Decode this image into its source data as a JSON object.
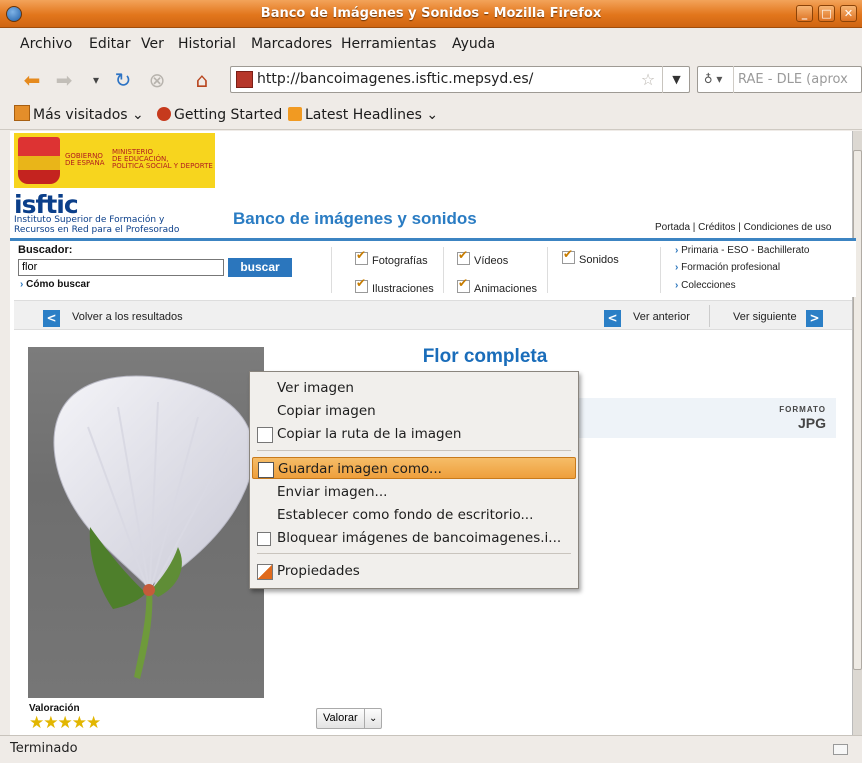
{
  "window": {
    "title": "Banco de Imágenes y Sonidos - Mozilla Firefox"
  },
  "menu": [
    "Archivo",
    "Editar",
    "Ver",
    "Historial",
    "Marcadores",
    "Herramientas",
    "Ayuda"
  ],
  "address": {
    "url": "http://bancoimagenes.isftic.mepsyd.es/"
  },
  "search_engine": {
    "placeholder": "RAE - DLE (aprox"
  },
  "bookmarks": [
    "Más visitados",
    "Getting Started",
    "Latest Headlines"
  ],
  "site": {
    "gov_text_1": "GOBIERNO",
    "gov_text_2": "DE ESPAÑA",
    "min_text_1": "MINISTERIO",
    "min_text_2": "DE EDUCACIÓN,",
    "min_text_3": "POLÍTICA SOCIAL Y DEPORTE",
    "logo": "isftic",
    "logo_sub_1": "Instituto Superior de Formación y",
    "logo_sub_2": "Recursos en Red para el Profesorado",
    "title": "Banco de imágenes y sonidos",
    "top_links": "Portada | Créditos | Condiciones de uso"
  },
  "search": {
    "label": "Buscador:",
    "value": "flor",
    "button": "buscar",
    "help": "Cómo buscar",
    "checks": {
      "fotografias": "Fotografías",
      "ilustraciones": "Ilustraciones",
      "videos": "Vídeos",
      "animaciones": "Animaciones",
      "sonidos": "Sonidos"
    },
    "levels": [
      "Primaria - ESO - Bachillerato",
      "Formación profesional",
      "Colecciones"
    ]
  },
  "result_nav": {
    "back": "Volver a los resultados",
    "prev": "Ver anterior",
    "next": "Ver siguiente"
  },
  "item": {
    "title": "Flor completa",
    "formato_label": "FORMATO",
    "formato_value": "JPG",
    "valoracion_label": "Valoración",
    "stars": "★★★★★",
    "valorar": "Valorar"
  },
  "context_menu": {
    "items": [
      "Ver imagen",
      "Copiar imagen",
      "Copiar la ruta de la imagen",
      "Guardar imagen como...",
      "Enviar imagen...",
      "Establecer como fondo de escritorio...",
      "Bloquear imágenes de bancoimagenes.i...",
      "Propiedades"
    ],
    "highlighted": "Guardar imagen como..."
  },
  "status": {
    "text": "Terminado"
  }
}
